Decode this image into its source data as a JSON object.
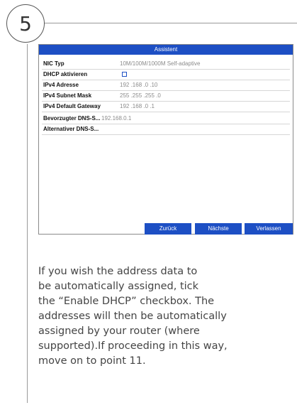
{
  "step": {
    "number": "5"
  },
  "dialog": {
    "title": "Assistent",
    "fields": [
      {
        "label": "NIC Typ",
        "value": "10M/100M/1000M Self-adaptive"
      },
      {
        "label": "DHCP aktivieren",
        "checked": false
      },
      {
        "label": "IPv4 Adresse",
        "value": "192 .168 .0    .10"
      },
      {
        "label": "IPv4 Subnet Mask",
        "value": "255 .255 .255 .0"
      },
      {
        "label": "IPv4 Default Gateway",
        "value": "192 .168 .0    .1"
      },
      {
        "label": "Bevorzugter DNS-S...",
        "value": "192.168.0.1"
      },
      {
        "label": "Alternativer DNS-S...",
        "value": ""
      }
    ],
    "buttons": {
      "back": "Zurück",
      "next": "Nächste",
      "exit": "Verlassen"
    }
  },
  "caption": {
    "lines": [
      "If you wish the address data to",
      "be automatically assigned, tick",
      "the “Enable DHCP” checkbox. The",
      "addresses will then be automatically",
      "assigned by your router (where",
      "supported).If proceeding in this way,",
      "move on to point 11."
    ]
  },
  "colors": {
    "accent": "#1d4fc4",
    "line": "#9a9a9a",
    "text": "#444444"
  }
}
